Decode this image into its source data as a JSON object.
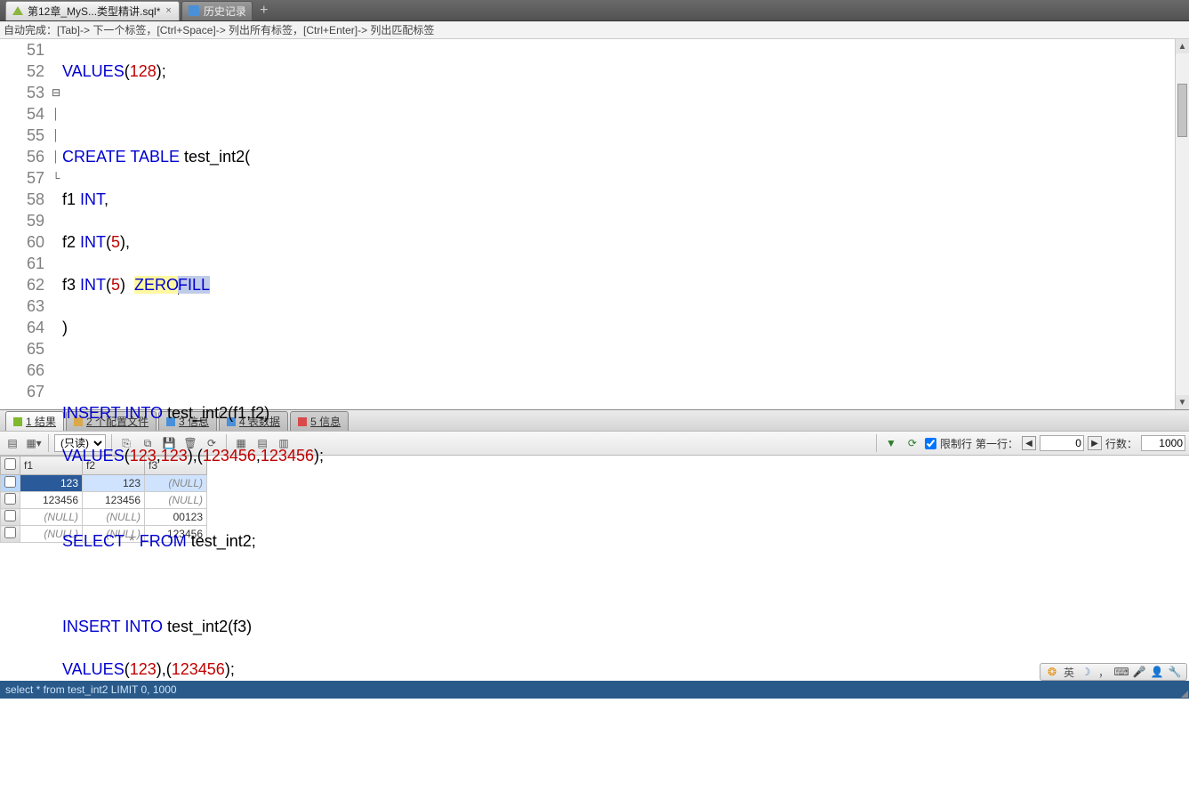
{
  "tabs": {
    "file": "第12章_MyS...类型精讲.sql*",
    "history": "历史记录"
  },
  "autocomplete": "自动完成：[Tab]-> 下一个标签，[Ctrl+Space]-> 列出所有标签，[Ctrl+Enter]-> 列出匹配标签",
  "code": {
    "l51_num": "51",
    "l51_kw": "VALUES",
    "l51_p1": "(",
    "l51_n": "128",
    "l51_p2": ");",
    "l52_num": "52",
    "l53_num": "53",
    "l53_kw": "CREATE TABLE",
    "l53_id": " test_int2(",
    "l54_num": "54",
    "l54_id": "f1 ",
    "l54_kw": "INT",
    "l54_p": ",",
    "l55_num": "55",
    "l55_id": "f2 ",
    "l55_kw": "INT",
    "l55_p1": "(",
    "l55_n": "5",
    "l55_p2": "),",
    "l56_num": "56",
    "l56_id": "f3 ",
    "l56_kw": "INT",
    "l56_p1": "(",
    "l56_n": "5",
    "l56_p2": ")  ",
    "l56_a": "ZERO",
    "l56_b": "FILL",
    "l57_num": "57",
    "l57_p": ")",
    "l58_num": "58",
    "l59_num": "59",
    "l59_kw1": "INSERT",
    "l59_kw2": " INTO",
    "l59_id": " test_int2(f1,f2)",
    "l60_num": "60",
    "l60_kw": "VALUES",
    "l60_p1": "(",
    "l60_n1": "123",
    "l60_p2": ",",
    "l60_n2": "123",
    "l60_p3": "),(",
    "l60_n3": "123456",
    "l60_p4": ",",
    "l60_n4": "123456",
    "l60_p5": ");",
    "l61_num": "61",
    "l62_num": "62",
    "l62_kw1": "SELECT",
    "l62_star": " * ",
    "l62_kw2": "FROM",
    "l62_id": " test_int2;",
    "l63_num": "63",
    "l64_num": "64",
    "l64_kw1": "INSERT",
    "l64_kw2": " INTO",
    "l64_id": " test_int2(f3)",
    "l65_num": "65",
    "l65_kw": "VALUES",
    "l65_p1": "(",
    "l65_n1": "123",
    "l65_p2": "),(",
    "l65_n2": "123456",
    "l65_p3": ");",
    "l66_num": "66",
    "l67_num": "67"
  },
  "restabs": {
    "r1": "1 结果",
    "r2": "2 个配置文件",
    "r3": "3 信息",
    "r4": "4 表数据",
    "r5": "5 信息"
  },
  "toolbar": {
    "readonly": "(只读)",
    "limit_lbl": "限制行",
    "firstrow_lbl": "第一行：",
    "firstrow_val": "0",
    "rows_lbl": "行数：",
    "rows_val": "1000"
  },
  "grid": {
    "h1": "f1",
    "h2": "f2",
    "h3": "f3",
    "rows": [
      {
        "f1": "123",
        "f2": "123",
        "f3": "(NULL)",
        "f3null": true
      },
      {
        "f1": "123456",
        "f2": "123456",
        "f3": "(NULL)",
        "f3null": true
      },
      {
        "f1": "(NULL)",
        "f2": "(NULL)",
        "f3": "00123",
        "f1null": true,
        "f2null": true
      },
      {
        "f1": "(NULL)",
        "f2": "(NULL)",
        "f3": "123456",
        "f1null": true,
        "f2null": true
      }
    ]
  },
  "status": "select * from test_int2 LIMIT 0, 1000",
  "ime": "英"
}
